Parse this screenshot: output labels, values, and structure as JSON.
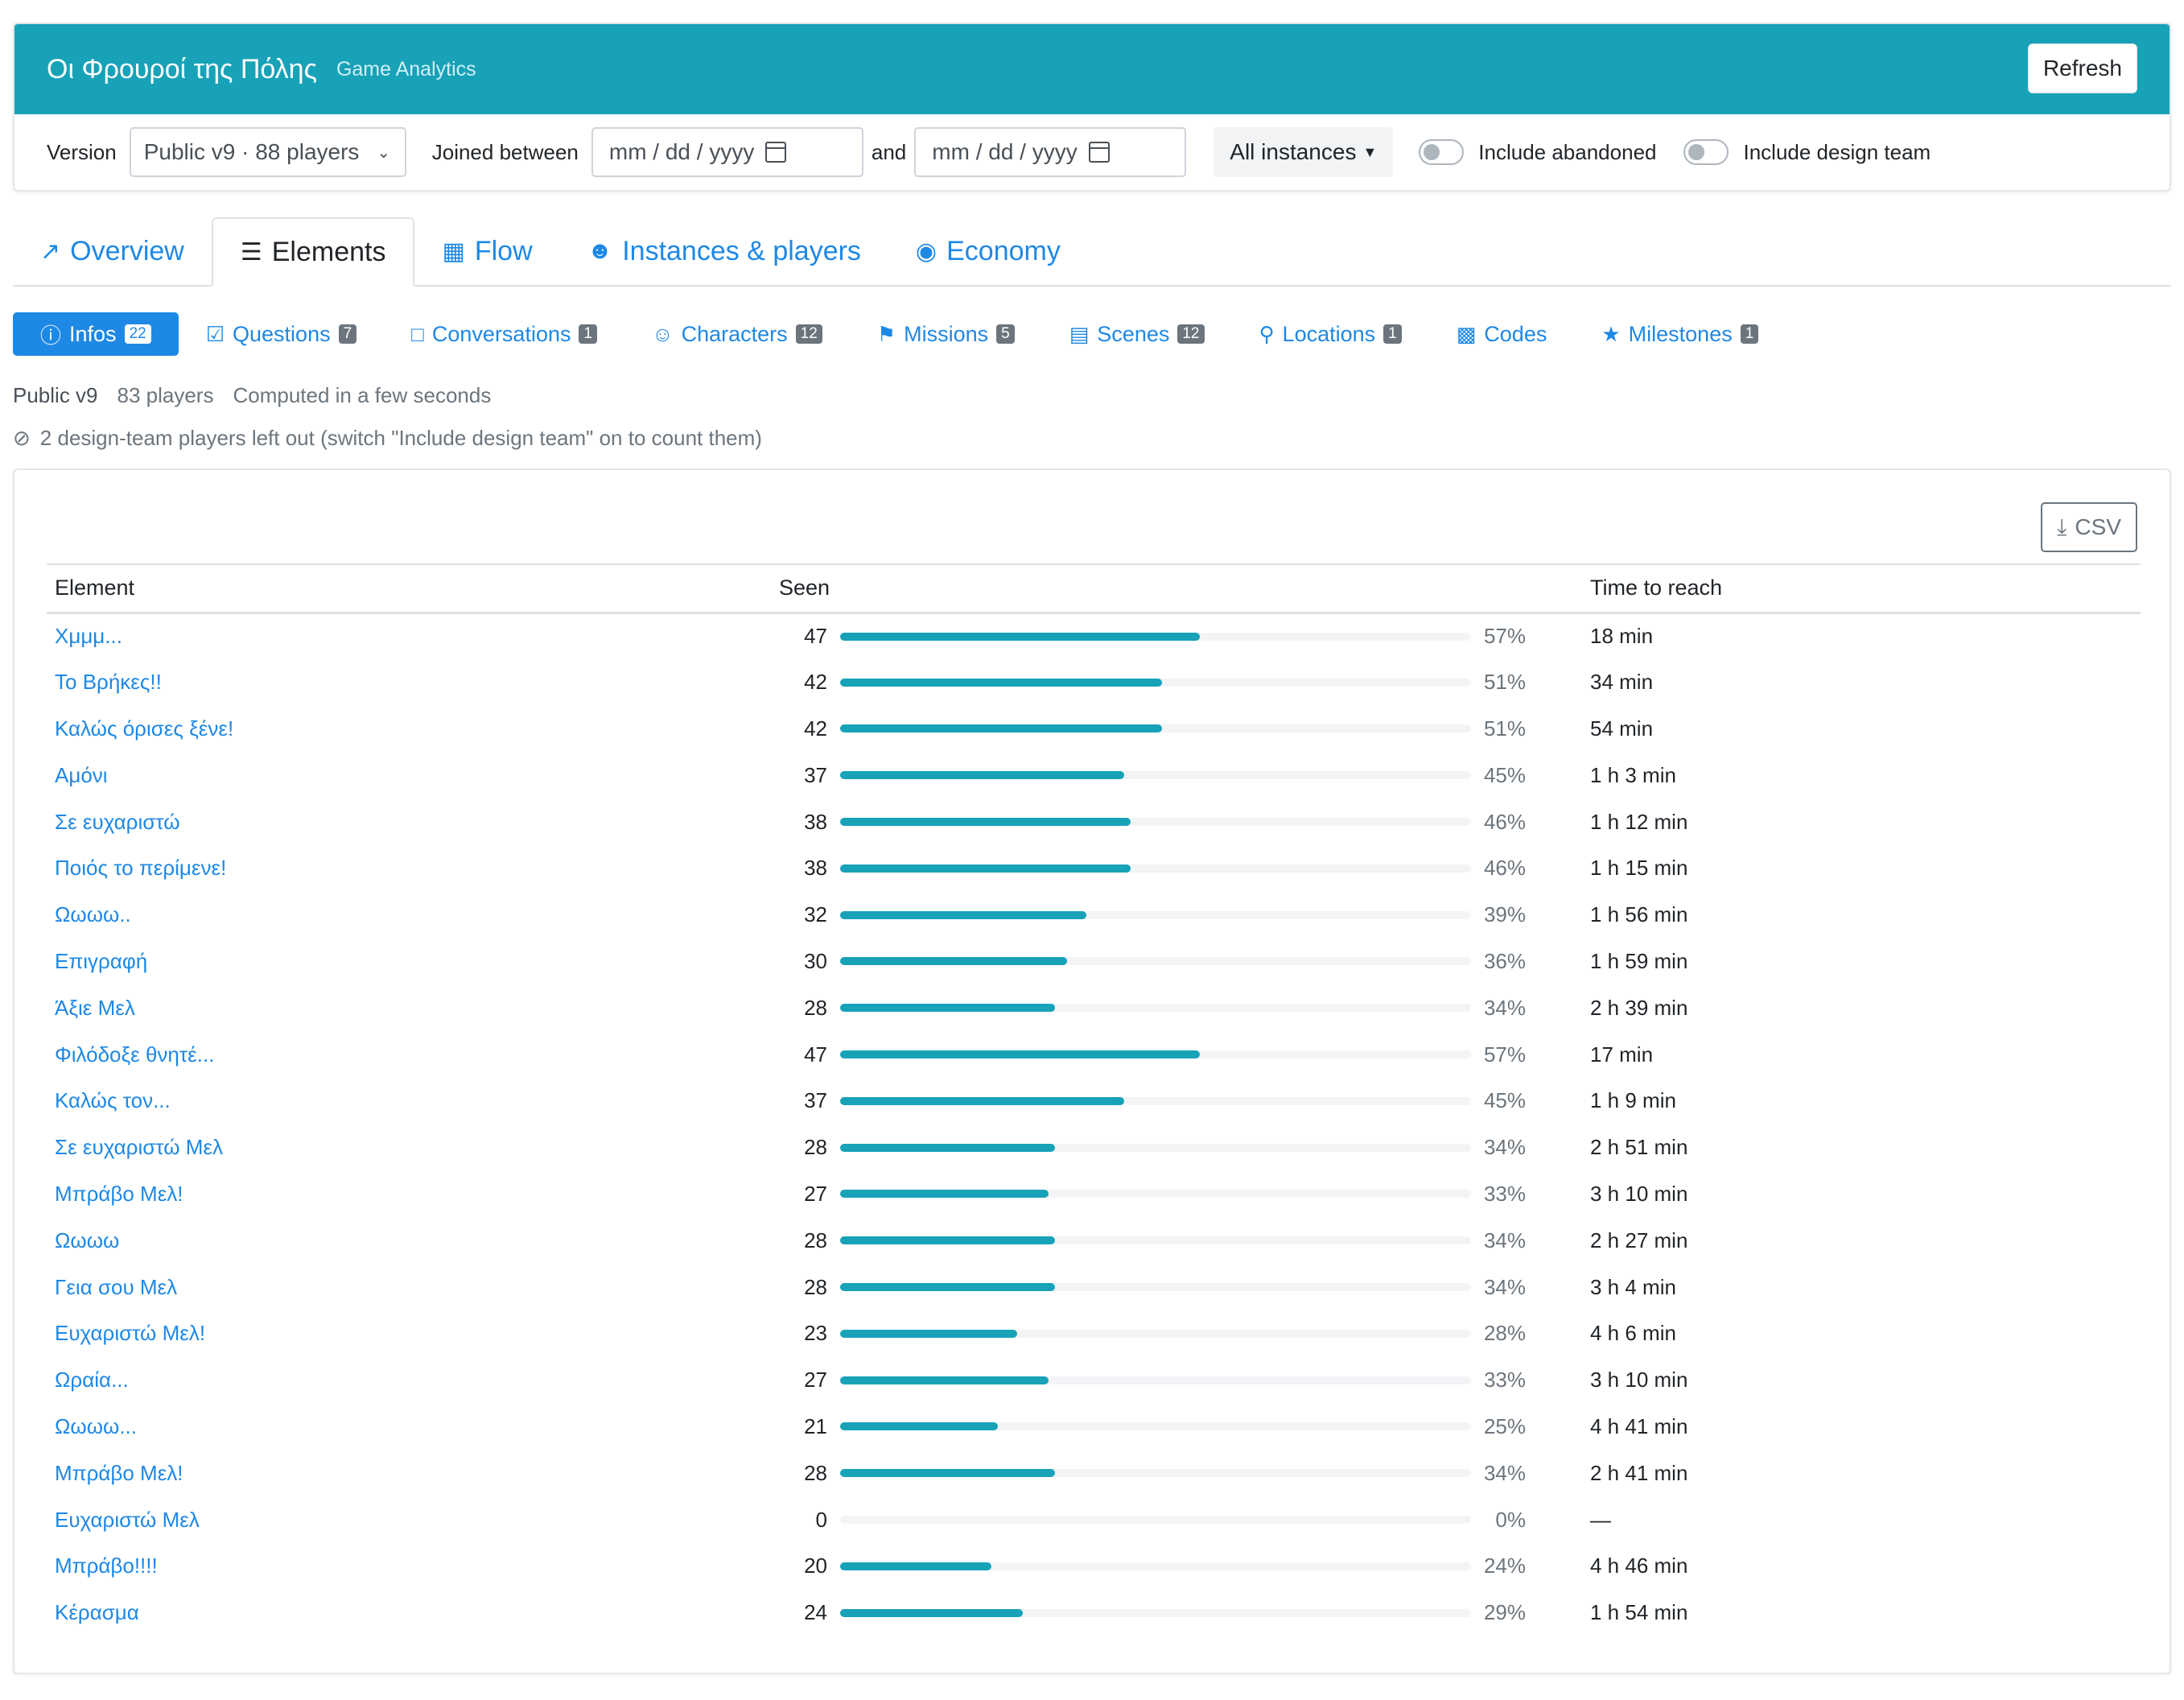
{
  "header": {
    "title": "Οι Φρουροί της Πόλης",
    "subtitle": "Game Analytics",
    "refresh_label": "Refresh"
  },
  "filters": {
    "version_label": "Version",
    "version_value": "Public v9 · 88 players",
    "joined_label": "Joined between",
    "date_from_placeholder": "mm / dd / yyyy",
    "and_label": "and",
    "date_to_placeholder": "mm / dd / yyyy",
    "instances_label": "All instances",
    "include_abandoned_label": "Include abandoned",
    "include_design_label": "Include design team"
  },
  "main_tabs": [
    {
      "label": "Overview",
      "icon": "trend-icon",
      "active": false
    },
    {
      "label": "Elements",
      "icon": "list-icon",
      "active": true
    },
    {
      "label": "Flow",
      "icon": "flow-icon",
      "active": false
    },
    {
      "label": "Instances & players",
      "icon": "users-icon",
      "active": false
    },
    {
      "label": "Economy",
      "icon": "piggy-bank-icon",
      "active": false
    }
  ],
  "sub_tabs": [
    {
      "label": "Infos",
      "count": "22",
      "active": true
    },
    {
      "label": "Questions",
      "count": "7"
    },
    {
      "label": "Conversations",
      "count": "1"
    },
    {
      "label": "Characters",
      "count": "12"
    },
    {
      "label": "Missions",
      "count": "5"
    },
    {
      "label": "Scenes",
      "count": "12"
    },
    {
      "label": "Locations",
      "count": "1"
    },
    {
      "label": "Codes",
      "count": ""
    },
    {
      "label": "Milestones",
      "count": "1"
    }
  ],
  "meta": {
    "version": "Public v9",
    "players": "83 players",
    "computed": "Computed in a few seconds",
    "note": "2 design-team players left out (switch \"Include design team\" on to count them)"
  },
  "table": {
    "csv_label": "CSV",
    "headers": {
      "element": "Element",
      "seen": "Seen",
      "time": "Time to reach"
    },
    "rows": [
      {
        "element": "Χμμμ...",
        "seen": "47",
        "pct": "57%",
        "fraction": 0.57,
        "time": "18 min"
      },
      {
        "element": "Το Βρήκες!!",
        "seen": "42",
        "pct": "51%",
        "fraction": 0.51,
        "time": "34 min"
      },
      {
        "element": "Καλώς όρισες ξένε!",
        "seen": "42",
        "pct": "51%",
        "fraction": 0.51,
        "time": "54 min"
      },
      {
        "element": "Αμόνι",
        "seen": "37",
        "pct": "45%",
        "fraction": 0.45,
        "time": "1 h 3 min"
      },
      {
        "element": "Σε ευχαριστώ",
        "seen": "38",
        "pct": "46%",
        "fraction": 0.46,
        "time": "1 h 12 min"
      },
      {
        "element": "Ποιός το περίμενε!",
        "seen": "38",
        "pct": "46%",
        "fraction": 0.46,
        "time": "1 h 15 min"
      },
      {
        "element": "Ωωωω..",
        "seen": "32",
        "pct": "39%",
        "fraction": 0.39,
        "time": "1 h 56 min"
      },
      {
        "element": "Επιγραφή",
        "seen": "30",
        "pct": "36%",
        "fraction": 0.36,
        "time": "1 h 59 min"
      },
      {
        "element": "Άξιε Μελ",
        "seen": "28",
        "pct": "34%",
        "fraction": 0.34,
        "time": "2 h 39 min"
      },
      {
        "element": "Φιλόδοξε θνητέ...",
        "seen": "47",
        "pct": "57%",
        "fraction": 0.57,
        "time": "17 min"
      },
      {
        "element": "Καλώς τον...",
        "seen": "37",
        "pct": "45%",
        "fraction": 0.45,
        "time": "1 h 9 min"
      },
      {
        "element": "Σε ευχαριστώ Μελ",
        "seen": "28",
        "pct": "34%",
        "fraction": 0.34,
        "time": "2 h 51 min"
      },
      {
        "element": "Μπράβο Μελ!",
        "seen": "27",
        "pct": "33%",
        "fraction": 0.33,
        "time": "3 h 10 min"
      },
      {
        "element": "Ωωωω",
        "seen": "28",
        "pct": "34%",
        "fraction": 0.34,
        "time": "2 h 27 min"
      },
      {
        "element": "Γεια σου Μελ",
        "seen": "28",
        "pct": "34%",
        "fraction": 0.34,
        "time": "3 h 4 min"
      },
      {
        "element": "Ευχαριστώ Μελ!",
        "seen": "23",
        "pct": "28%",
        "fraction": 0.28,
        "time": "4 h 6 min"
      },
      {
        "element": "Ωραία...",
        "seen": "27",
        "pct": "33%",
        "fraction": 0.33,
        "time": "3 h 10 min"
      },
      {
        "element": "Ωωωω...",
        "seen": "21",
        "pct": "25%",
        "fraction": 0.25,
        "time": "4 h 41 min"
      },
      {
        "element": "Μπράβο Μελ!",
        "seen": "28",
        "pct": "34%",
        "fraction": 0.34,
        "time": "2 h 41 min"
      },
      {
        "element": "Ευχαριστώ Μελ",
        "seen": "0",
        "pct": "0%",
        "fraction": 0,
        "time": "—"
      },
      {
        "element": "Μπράβο!!!!",
        "seen": "20",
        "pct": "24%",
        "fraction": 0.24,
        "time": "4 h 46 min"
      },
      {
        "element": "Κέρασμα",
        "seen": "24",
        "pct": "29%",
        "fraction": 0.29,
        "time": "1 h 54 min"
      }
    ]
  },
  "colors": {
    "accent": "#17a2b8",
    "link": "#1e88e5",
    "muted": "#6c757d"
  }
}
